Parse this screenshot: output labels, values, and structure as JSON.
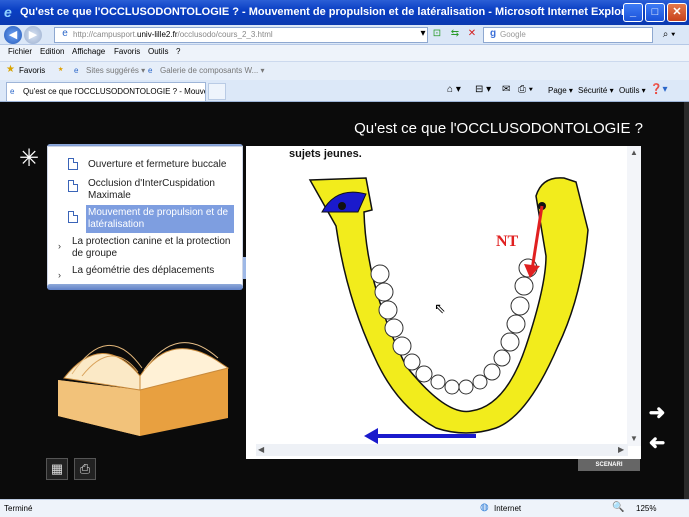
{
  "window": {
    "title": "Qu'est ce que l'OCCLUSODONTOLOGIE ? - Mouvement de propulsion et de latéralisation - Microsoft Internet Explorer",
    "minimize": "_",
    "maximize": "□",
    "close": "✕"
  },
  "address": {
    "prefix": "http://campusport.",
    "domain": "univ-lille2.fr",
    "path": "/occlusodo/cours_2_3.html",
    "search_placeholder": "Google"
  },
  "menu": [
    "Fichier",
    "Edition",
    "Affichage",
    "Favoris",
    "Outils",
    "?"
  ],
  "favorites": {
    "label": "Favoris",
    "items": [
      "Sites suggérés ▾",
      "Galerie de composants W... ▾"
    ]
  },
  "tab": {
    "label": "Qu'est ce que l'OCCLUSODONTOLOGIE ? - Mouvemen..."
  },
  "command_bar": {
    "page": "Page ▾",
    "security": "Sécurité ▾",
    "tools": "Outils ▾"
  },
  "app": {
    "title": "Qu'est ce que l'OCCLUSODONTOLOGIE ?",
    "nav_items": [
      {
        "label": "Ouverture et fermeture buccale",
        "type": "doc"
      },
      {
        "label": "Occlusion d'InterCuspidation Maximale",
        "type": "doc"
      },
      {
        "label": "Mouvement de propulsion et de latéralisation",
        "type": "doc",
        "selected": true
      },
      {
        "label": "La protection canine et la protection de groupe",
        "type": "section"
      },
      {
        "label": "La géométrie des déplacements",
        "type": "section"
      }
    ],
    "main_text": "sujets jeunes.",
    "diagram_label": "NT",
    "scenari": "SCENARI"
  },
  "status": {
    "left": "Terminé",
    "zone": "Internet",
    "zoom": "125%"
  },
  "colors": {
    "diagram_yellow": "#f2ec1c",
    "arrow_red": "#e02020",
    "arrow_blue": "#1a1acc",
    "selected_nav": "#7e9ee0"
  }
}
